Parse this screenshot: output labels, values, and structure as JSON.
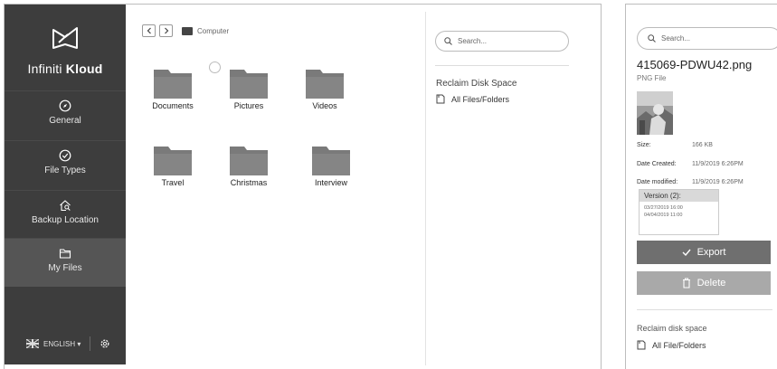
{
  "app": {
    "brand_regular": "Infiniti ",
    "brand_bold": "Kloud"
  },
  "sidebar": {
    "items": [
      {
        "label": "General",
        "icon": "compass-icon"
      },
      {
        "label": "File Types",
        "icon": "check-circle-icon"
      },
      {
        "label": "Backup Location",
        "icon": "home-search-icon"
      },
      {
        "label": "My Files",
        "icon": "folder-icon",
        "active": true
      }
    ],
    "language": "ENGLISH ▾",
    "flag_icon": "uk-flag-icon",
    "settings_icon": "gear-icon"
  },
  "breadcrumb": {
    "location": "Computer"
  },
  "folders": [
    {
      "label": "Documents"
    },
    {
      "label": "Pictures"
    },
    {
      "label": "Videos"
    },
    {
      "label": "Travel"
    },
    {
      "label": "Christmas"
    },
    {
      "label": "Interview"
    }
  ],
  "right_panel": {
    "search_placeholder": "Search...",
    "reclaim_title": "Reclaim Disk Space",
    "all_files": "All Files/Folders"
  },
  "detail": {
    "search_placeholder": "Search...",
    "file_name": "415069-PDWU42.png",
    "file_type": "PNG File",
    "size_label": "Size:",
    "size_value": "166 KB",
    "created_label": "Date Created:",
    "created_value": "11/9/2019 6:26PM",
    "modified_label": "Date modified:",
    "modified_value": "11/9/2019 6:26PM",
    "version_title": "Version (2):",
    "versions": [
      "03/27/2019 16:00",
      "04/04/2019 11:00"
    ],
    "export_label": "Export",
    "delete_label": "Delete",
    "reclaim_title": "Reclaim disk space",
    "all_files": "All File/Folders"
  },
  "colors": {
    "sidebar_bg": "#3d3d3d",
    "sidebar_active": "#555555",
    "export_bg": "#6f6f6f",
    "delete_bg": "#a9a9a9",
    "folder_fill": "#7a7a7a"
  }
}
